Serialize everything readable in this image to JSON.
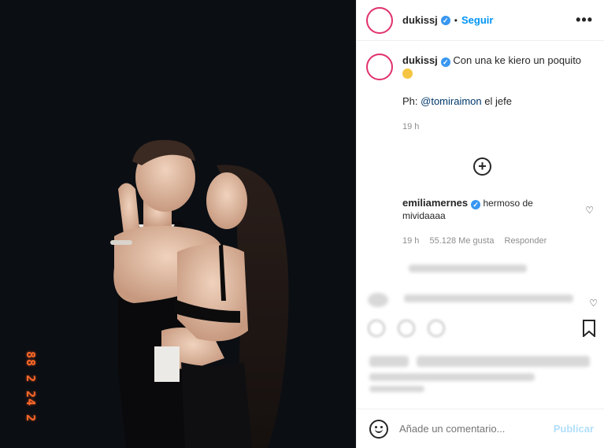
{
  "post": {
    "photo_date_stamp": "88 2 24 2",
    "photo_alt": "couple photo"
  },
  "header": {
    "username": "dukissj",
    "verified_mark": "✓",
    "dot": "•",
    "follow_label": "Seguir",
    "more_label": "•••"
  },
  "caption": {
    "username": "dukissj",
    "text": "Con una ke kiero un poquito",
    "ph_prefix": "Ph:",
    "ph_mention": "@tomiraimon",
    "ph_suffix": "el jefe",
    "time": "19 h"
  },
  "load_more_label": "+",
  "comment": {
    "username": "emiliamernes",
    "text": "hermoso de mividaaaa",
    "time": "19 h",
    "likes": "55.128 Me gusta",
    "reply": "Responder"
  },
  "comment_bar": {
    "placeholder": "Añade un comentario...",
    "publish_label": "Publicar"
  },
  "colors": {
    "follow": "#0095f6",
    "verified": "#3897f0",
    "publish_disabled": "#b2dffc",
    "avatar_ring": "#e1306c"
  },
  "icons": [
    "verified-icon",
    "more-icon",
    "add-comment-icon",
    "heart-icon",
    "bookmark-icon",
    "emoji-icon",
    "like-icon",
    "comment-icon",
    "share-icon"
  ]
}
